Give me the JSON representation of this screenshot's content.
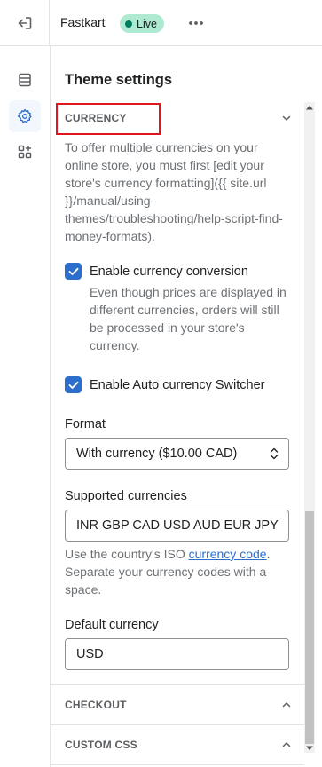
{
  "header": {
    "store_name": "Fastkart",
    "status_badge": "Live"
  },
  "rail": {
    "items": [
      {
        "name": "sections",
        "icon": "sections-icon"
      },
      {
        "name": "theme-settings",
        "icon": "gear-icon",
        "active": true
      },
      {
        "name": "app-embeds",
        "icon": "apps-icon"
      }
    ]
  },
  "panel": {
    "title": "Theme settings",
    "currency": {
      "heading": "CURRENCY",
      "description": "To offer multiple currencies on your online store, you must first [edit your store's currency formatting]({{ site.url }}/manual/using-themes/troubleshooting/help-script-find-money-formats).",
      "enable_conversion": {
        "label": "Enable currency conversion",
        "checked": true,
        "help": "Even though prices are displayed in different currencies, orders will still be processed in your store's currency."
      },
      "enable_switcher": {
        "label": "Enable Auto currency Switcher",
        "checked": true
      },
      "format": {
        "label": "Format",
        "value": "With currency ($10.00 CAD)"
      },
      "supported": {
        "label": "Supported currencies",
        "value": "INR GBP CAD USD AUD EUR JPY",
        "help_prefix": "Use the country's ISO ",
        "help_link": "currency code",
        "help_suffix": ". Separate your currency codes with a space."
      },
      "default_currency": {
        "label": "Default currency",
        "value": "USD"
      }
    },
    "checkout": {
      "heading": "CHECKOUT"
    },
    "custom_css": {
      "heading": "CUSTOM CSS"
    }
  },
  "colors": {
    "accent": "#2c6ecb",
    "live_badge": "#aee9d1",
    "highlight": "#e1161c"
  }
}
